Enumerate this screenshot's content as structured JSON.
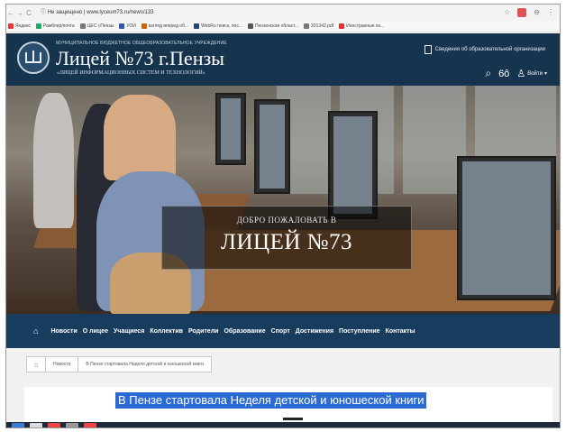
{
  "browser": {
    "nav_back": "←",
    "nav_forward": "→",
    "nav_reload": "C",
    "url": "ⓘ  Не защищено  |  www.lyceum73.ru/news/133",
    "bookmarks": [
      {
        "label": "Яндекс",
        "color": "#e33"
      },
      {
        "label": "Рамблер/почта",
        "color": "#2a6"
      },
      {
        "label": "ЦЕС г.Пензы",
        "color": "#777"
      },
      {
        "label": "УОИ",
        "color": "#35a"
      },
      {
        "label": "взгляд вперед об...",
        "color": "#c60"
      },
      {
        "label": "WebRu поиск, пос...",
        "color": "#247"
      },
      {
        "label": "Пензенская област...",
        "color": "#555"
      },
      {
        "label": "201342.pdf",
        "color": "#777"
      },
      {
        "label": "Иностранные яз...",
        "color": "#d33"
      }
    ]
  },
  "header": {
    "org_name": "МУНИЦИПАЛЬНОЕ БЮДЖЕТНОЕ ОБЩЕОБРАЗОВАТЕЛЬНОЕ УЧРЕЖДЕНИЕ",
    "title": "Лицей №73 г.Пензы",
    "subtitle": "«ЛИЦЕЙ ИНФОРМАЦИОННЫХ СИСТЕМ И ТЕХНОЛОГИЙ»",
    "doc_link": "Сведения об образовательной организации",
    "login_label": "Войти"
  },
  "hero": {
    "welcome_small": "ДОБРО ПОЖАЛОВАТЬ В",
    "welcome_big": "ЛИЦЕЙ №73"
  },
  "nav": {
    "items": [
      "Новости",
      "О лицее",
      "Учащиеся",
      "Коллектив",
      "Родители",
      "Образование",
      "Спорт",
      "Достижения",
      "Поступление",
      "Контакты"
    ]
  },
  "breadcrumb": {
    "news": "Новости",
    "current": "В Пензе стартовала Неделя детской и юношеской книги"
  },
  "article": {
    "title": "В Пензе стартовала Неделя детской и юношеской книги"
  },
  "colors": {
    "header_bg": "#16344e",
    "nav_bg": "#173c5e",
    "title_highlight": "#2c6ad3"
  }
}
